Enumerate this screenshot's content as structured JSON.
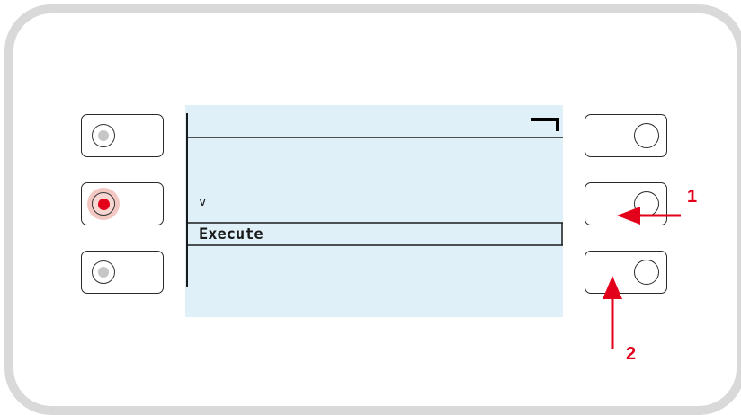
{
  "display": {
    "value_indicator": "v",
    "selected_item": "Execute"
  },
  "left_buttons": [
    {
      "led": "off"
    },
    {
      "led": "on"
    },
    {
      "led": "off"
    }
  ],
  "annotations": {
    "callout_1": "1",
    "callout_2": "2"
  },
  "colors": {
    "frame": "#d9d9da",
    "screen_bg": "#dff0f8",
    "led_active": "#e3001b",
    "annotation": "#e3001b"
  }
}
